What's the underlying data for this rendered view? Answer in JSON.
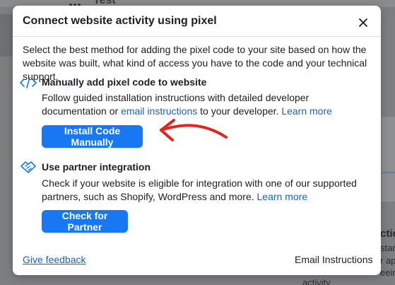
{
  "background": {
    "page_title": "Test",
    "right_texts": [
      "ctic",
      "start",
      "r app",
      "eein"
    ],
    "bottom_text": "activity"
  },
  "modal": {
    "title": "Connect website activity using pixel",
    "intro": "Select the best method for adding the pixel code to your site based on how the website was built, what kind of access you have to the code and your technical support.",
    "manual": {
      "icon": "code-icon",
      "title": "Manually add pixel code to website",
      "desc_prefix": "Follow guided installation instructions with detailed developer documentation or ",
      "email_link": "email instructions",
      "desc_middle": " to your developer. ",
      "learn_more": "Learn more",
      "button_label": "Install Code Manually"
    },
    "partner": {
      "icon": "handshake-icon",
      "title": "Use partner integration",
      "desc": "Check if your website is eligible for integration with one of our supported partners, such as Shopify, WordPress and more. ",
      "learn_more": "Learn more",
      "button_label": "Check for Partner"
    },
    "footer": {
      "feedback_link": "Give feedback",
      "email_instructions": "Email Instructions"
    }
  },
  "colors": {
    "primary": "#1877f2",
    "link": "#1861c9",
    "annotation_arrow": "#e0261e"
  }
}
